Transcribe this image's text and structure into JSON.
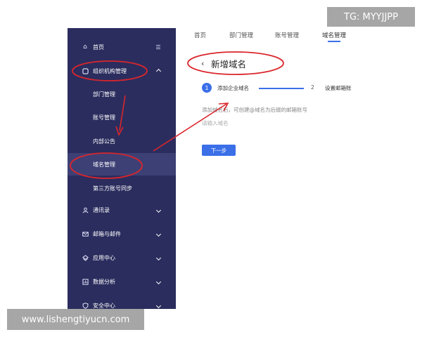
{
  "sidebar": {
    "home": {
      "label": "首页",
      "icon": "home-icon",
      "collapse_glyph": "☰"
    },
    "org": {
      "label": "组织机构管理",
      "icon": "org-icon"
    },
    "sub_items": [
      {
        "label": "部门管理"
      },
      {
        "label": "账号管理"
      },
      {
        "label": "内部公告"
      },
      {
        "label": "域名管理"
      },
      {
        "label": "第三方账号同步"
      }
    ],
    "sections": [
      {
        "label": "通讯录",
        "icon": "contacts-icon"
      },
      {
        "label": "邮箱与邮件",
        "icon": "mail-icon"
      },
      {
        "label": "应用中心",
        "icon": "app-center-icon"
      },
      {
        "label": "数据分析",
        "icon": "analytics-icon"
      },
      {
        "label": "安全中心",
        "icon": "security-icon"
      }
    ]
  },
  "tabs": [
    {
      "label": "首页"
    },
    {
      "label": "部门管理"
    },
    {
      "label": "账号管理"
    },
    {
      "label": "域名管理"
    }
  ],
  "main": {
    "back_glyph": "‹",
    "title": "新增域名",
    "steps": [
      {
        "number": "1",
        "label": "添加企业域名"
      },
      {
        "number": "2",
        "label": "设置邮箱账"
      }
    ],
    "hint": "添加域名后，可创建@域名为后缀的邮箱账号",
    "input_placeholder": "请输入域名",
    "next_label": "下一步"
  },
  "overlays": {
    "tg_text": "TG: MYYJJPP",
    "site_text": "www.lishengtiyucn.com"
  },
  "colors": {
    "sidebar_bg": "#2b2d5e",
    "accent": "#3b6fe8",
    "annotation": "#d9262c"
  }
}
